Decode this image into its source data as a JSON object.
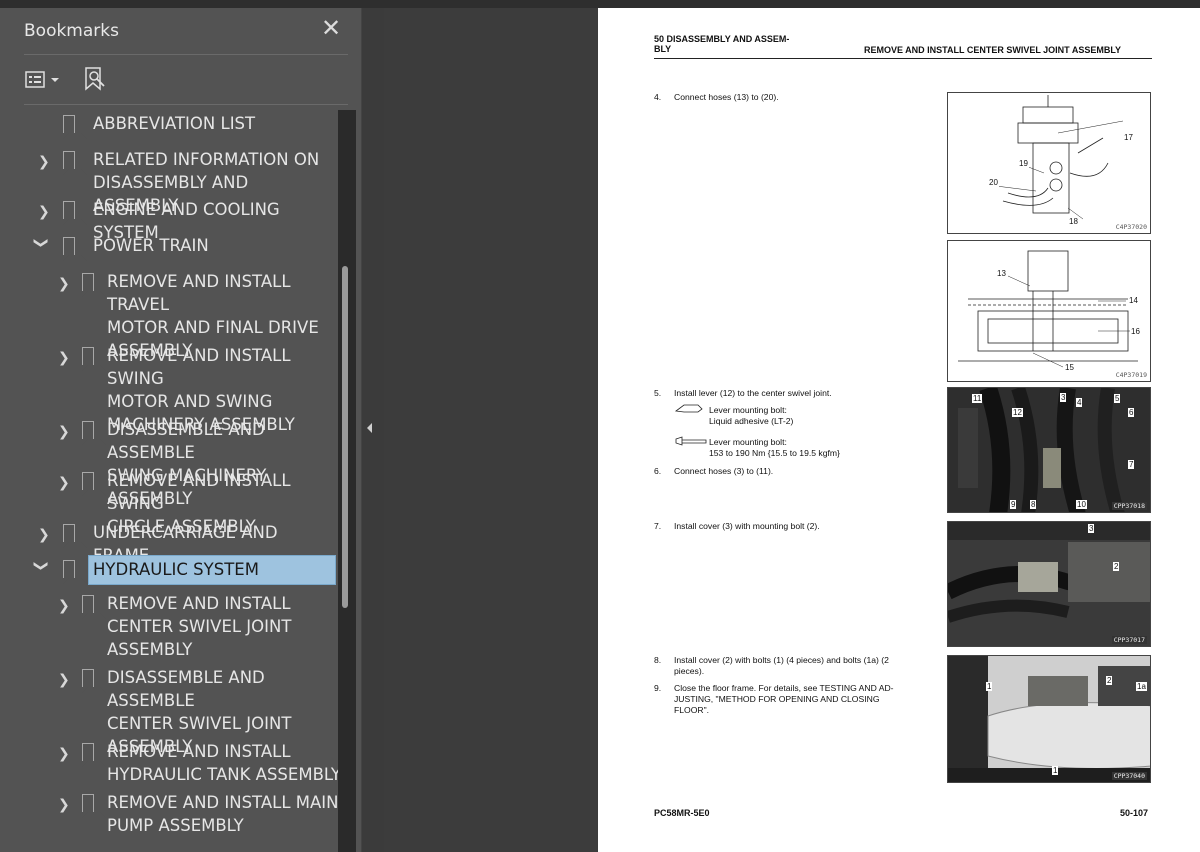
{
  "sidebar": {
    "title": "Bookmarks",
    "close_label": "✕",
    "items": [
      {
        "label": "ABBREVIATION LIST",
        "expandable": false,
        "expanded": false,
        "level": 0
      },
      {
        "label": "RELATED INFORMATION ON\nDISASSEMBLY AND ASSEMBLY",
        "expandable": true,
        "expanded": false,
        "level": 0
      },
      {
        "label": "ENGINE AND COOLING SYSTEM",
        "expandable": true,
        "expanded": false,
        "level": 0
      },
      {
        "label": "POWER TRAIN",
        "expandable": true,
        "expanded": true,
        "level": 0
      },
      {
        "label": "REMOVE AND INSTALL TRAVEL\nMOTOR AND FINAL DRIVE\nASSEMBLY",
        "expandable": true,
        "expanded": false,
        "level": 1
      },
      {
        "label": "REMOVE AND INSTALL SWING\nMOTOR AND SWING\nMACHINERY ASSEMBLY",
        "expandable": true,
        "expanded": false,
        "level": 1
      },
      {
        "label": "DISASSEMBLE AND ASSEMBLE\nSWING MACHINERY ASSEMBLY",
        "expandable": true,
        "expanded": false,
        "level": 1
      },
      {
        "label": "REMOVE AND INSTALL SWING\nCIRCLE ASSEMBLY",
        "expandable": true,
        "expanded": false,
        "level": 1
      },
      {
        "label": "UNDERCARRIAGE AND FRAME",
        "expandable": true,
        "expanded": false,
        "level": 0
      },
      {
        "label": "HYDRAULIC SYSTEM",
        "expandable": true,
        "expanded": true,
        "level": 0,
        "selected": true
      },
      {
        "label": "REMOVE AND INSTALL\nCENTER SWIVEL JOINT\nASSEMBLY",
        "expandable": true,
        "expanded": false,
        "level": 1
      },
      {
        "label": "DISASSEMBLE AND ASSEMBLE\nCENTER SWIVEL JOINT\nASSEMBLY",
        "expandable": true,
        "expanded": false,
        "level": 1
      },
      {
        "label": "REMOVE AND INSTALL\nHYDRAULIC TANK ASSEMBLY",
        "expandable": true,
        "expanded": false,
        "level": 1
      },
      {
        "label": "REMOVE AND INSTALL MAIN\nPUMP ASSEMBLY",
        "expandable": true,
        "expanded": false,
        "level": 1
      }
    ]
  },
  "page": {
    "header_left": "50 DISASSEMBLY AND ASSEM-\nBLY",
    "header_right": "REMOVE AND INSTALL CENTER SWIVEL JOINT ASSEMBLY",
    "step4_num": "4.",
    "step4_text": "Connect hoses (13) to (20).",
    "step5_num": "5.",
    "step5_text": "Install lever (12) to the center swivel joint.",
    "adhesive_text": "Lever mounting bolt:\nLiquid adhesive (LT-2)",
    "torque_text": "Lever mounting bolt:\n153 to 190 Nm {15.5 to 19.5 kgfm}",
    "step6_num": "6.",
    "step6_text": "Connect hoses (3) to (11).",
    "step7_num": "7.",
    "step7_text": "Install cover (3) with mounting bolt (2).",
    "step8_num": "8.",
    "step8_text": "Install cover (2) with bolts (1) (4 pieces) and bolts (1a) (2\npieces).",
    "step9_num": "9.",
    "step9_text": "Close the floor frame. For details, see TESTING AND AD-\nJUSTING, \"METHOD FOR OPENING AND CLOSING\nFLOOR\".",
    "figures": {
      "fig1_code": "C4P37020",
      "fig1_labels": [
        "17",
        "19",
        "20",
        "18"
      ],
      "fig2_code": "C4P37019",
      "fig2_labels": [
        "13",
        "14",
        "16",
        "15"
      ],
      "fig3_code": "CPP37018",
      "fig3_labels": [
        "11",
        "12",
        "3",
        "4",
        "5",
        "6",
        "7",
        "9",
        "8",
        "10"
      ],
      "fig4_code": "CPP37017",
      "fig4_labels": [
        "3",
        "2"
      ],
      "fig5_code": "CPP37040",
      "fig5_labels": [
        "1",
        "2",
        "1a",
        "1"
      ]
    },
    "footer_left": "PC58MR-5E0",
    "footer_right": "50-107"
  }
}
